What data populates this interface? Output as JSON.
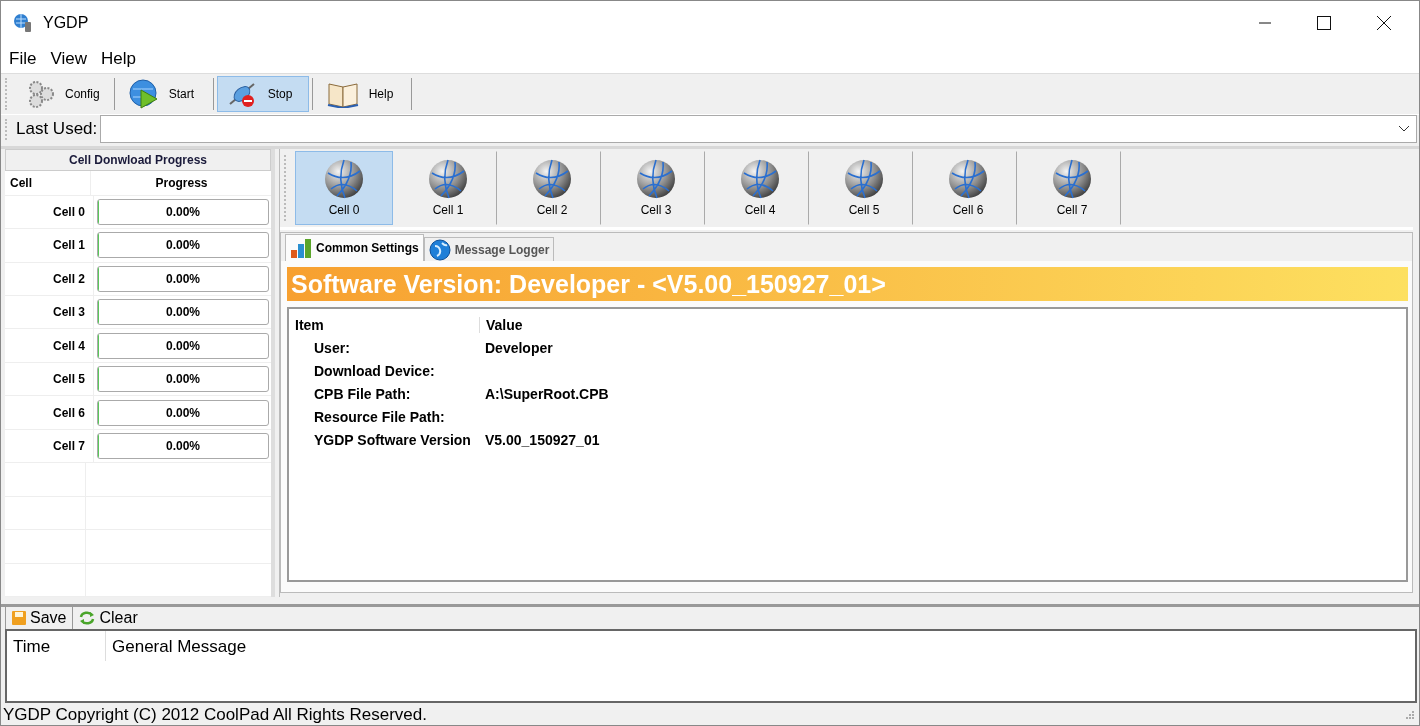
{
  "window": {
    "title": "YGDP"
  },
  "menu": [
    "File",
    "View",
    "Help"
  ],
  "toolbar": [
    {
      "label": "Config",
      "kind": "gears",
      "selected": false
    },
    {
      "label": "Start",
      "kind": "play",
      "selected": false
    },
    {
      "label": "Stop",
      "kind": "stop",
      "selected": true
    },
    {
      "label": "Help",
      "kind": "book",
      "selected": false
    }
  ],
  "last_used": {
    "label": "Last Used:"
  },
  "progress_panel": {
    "title": "Cell Donwload Progress",
    "columns": [
      "Cell",
      "Progress"
    ],
    "rows": [
      {
        "cell": "Cell 0",
        "progress": "0.00%",
        "level": 0
      },
      {
        "cell": "Cell 1",
        "progress": "0.00%",
        "level": 0
      },
      {
        "cell": "Cell 2",
        "progress": "0.00%",
        "level": 0
      },
      {
        "cell": "Cell 3",
        "progress": "0.00%",
        "level": 0
      },
      {
        "cell": "Cell 4",
        "progress": "0.00%",
        "level": 0
      },
      {
        "cell": "Cell 5",
        "progress": "0.00%",
        "level": 0
      },
      {
        "cell": "Cell 6",
        "progress": "0.00%",
        "level": 0
      },
      {
        "cell": "Cell 7",
        "progress": "0.00%",
        "level": 0
      }
    ]
  },
  "cells": [
    {
      "label": "Cell 0",
      "selected": true
    },
    {
      "label": "Cell 1",
      "selected": false
    },
    {
      "label": "Cell 2",
      "selected": false
    },
    {
      "label": "Cell 3",
      "selected": false
    },
    {
      "label": "Cell 4",
      "selected": false
    },
    {
      "label": "Cell 5",
      "selected": false
    },
    {
      "label": "Cell 6",
      "selected": false
    },
    {
      "label": "Cell 7",
      "selected": false
    }
  ],
  "tabs": [
    {
      "label": "Common Settings",
      "kind": "chart",
      "selected": true
    },
    {
      "label": "Message Logger",
      "kind": "globe",
      "selected": false
    }
  ],
  "banner": "Software Version:  Developer - <V5.00_150927_01>",
  "info_table": {
    "columns": [
      "Item",
      "Value"
    ],
    "rows": [
      {
        "item": "User:",
        "value": "Developer"
      },
      {
        "item": "Download Device:"
      },
      {
        "item": "CPB File Path:",
        "value": "A:\\SuperRoot.CPB"
      },
      {
        "item": "Resource File Path:"
      },
      {
        "item": "YGDP Software Version",
        "value": "V5.00_150927_01"
      }
    ]
  },
  "log": {
    "buttons": [
      {
        "label": "Save",
        "kind": "disk"
      },
      {
        "label": "Clear",
        "kind": "refresh"
      }
    ],
    "columns": [
      "Time",
      "General Message"
    ]
  },
  "status_bar": "YGDP Copyright (C) 2012 CoolPad All Rights Reserved."
}
